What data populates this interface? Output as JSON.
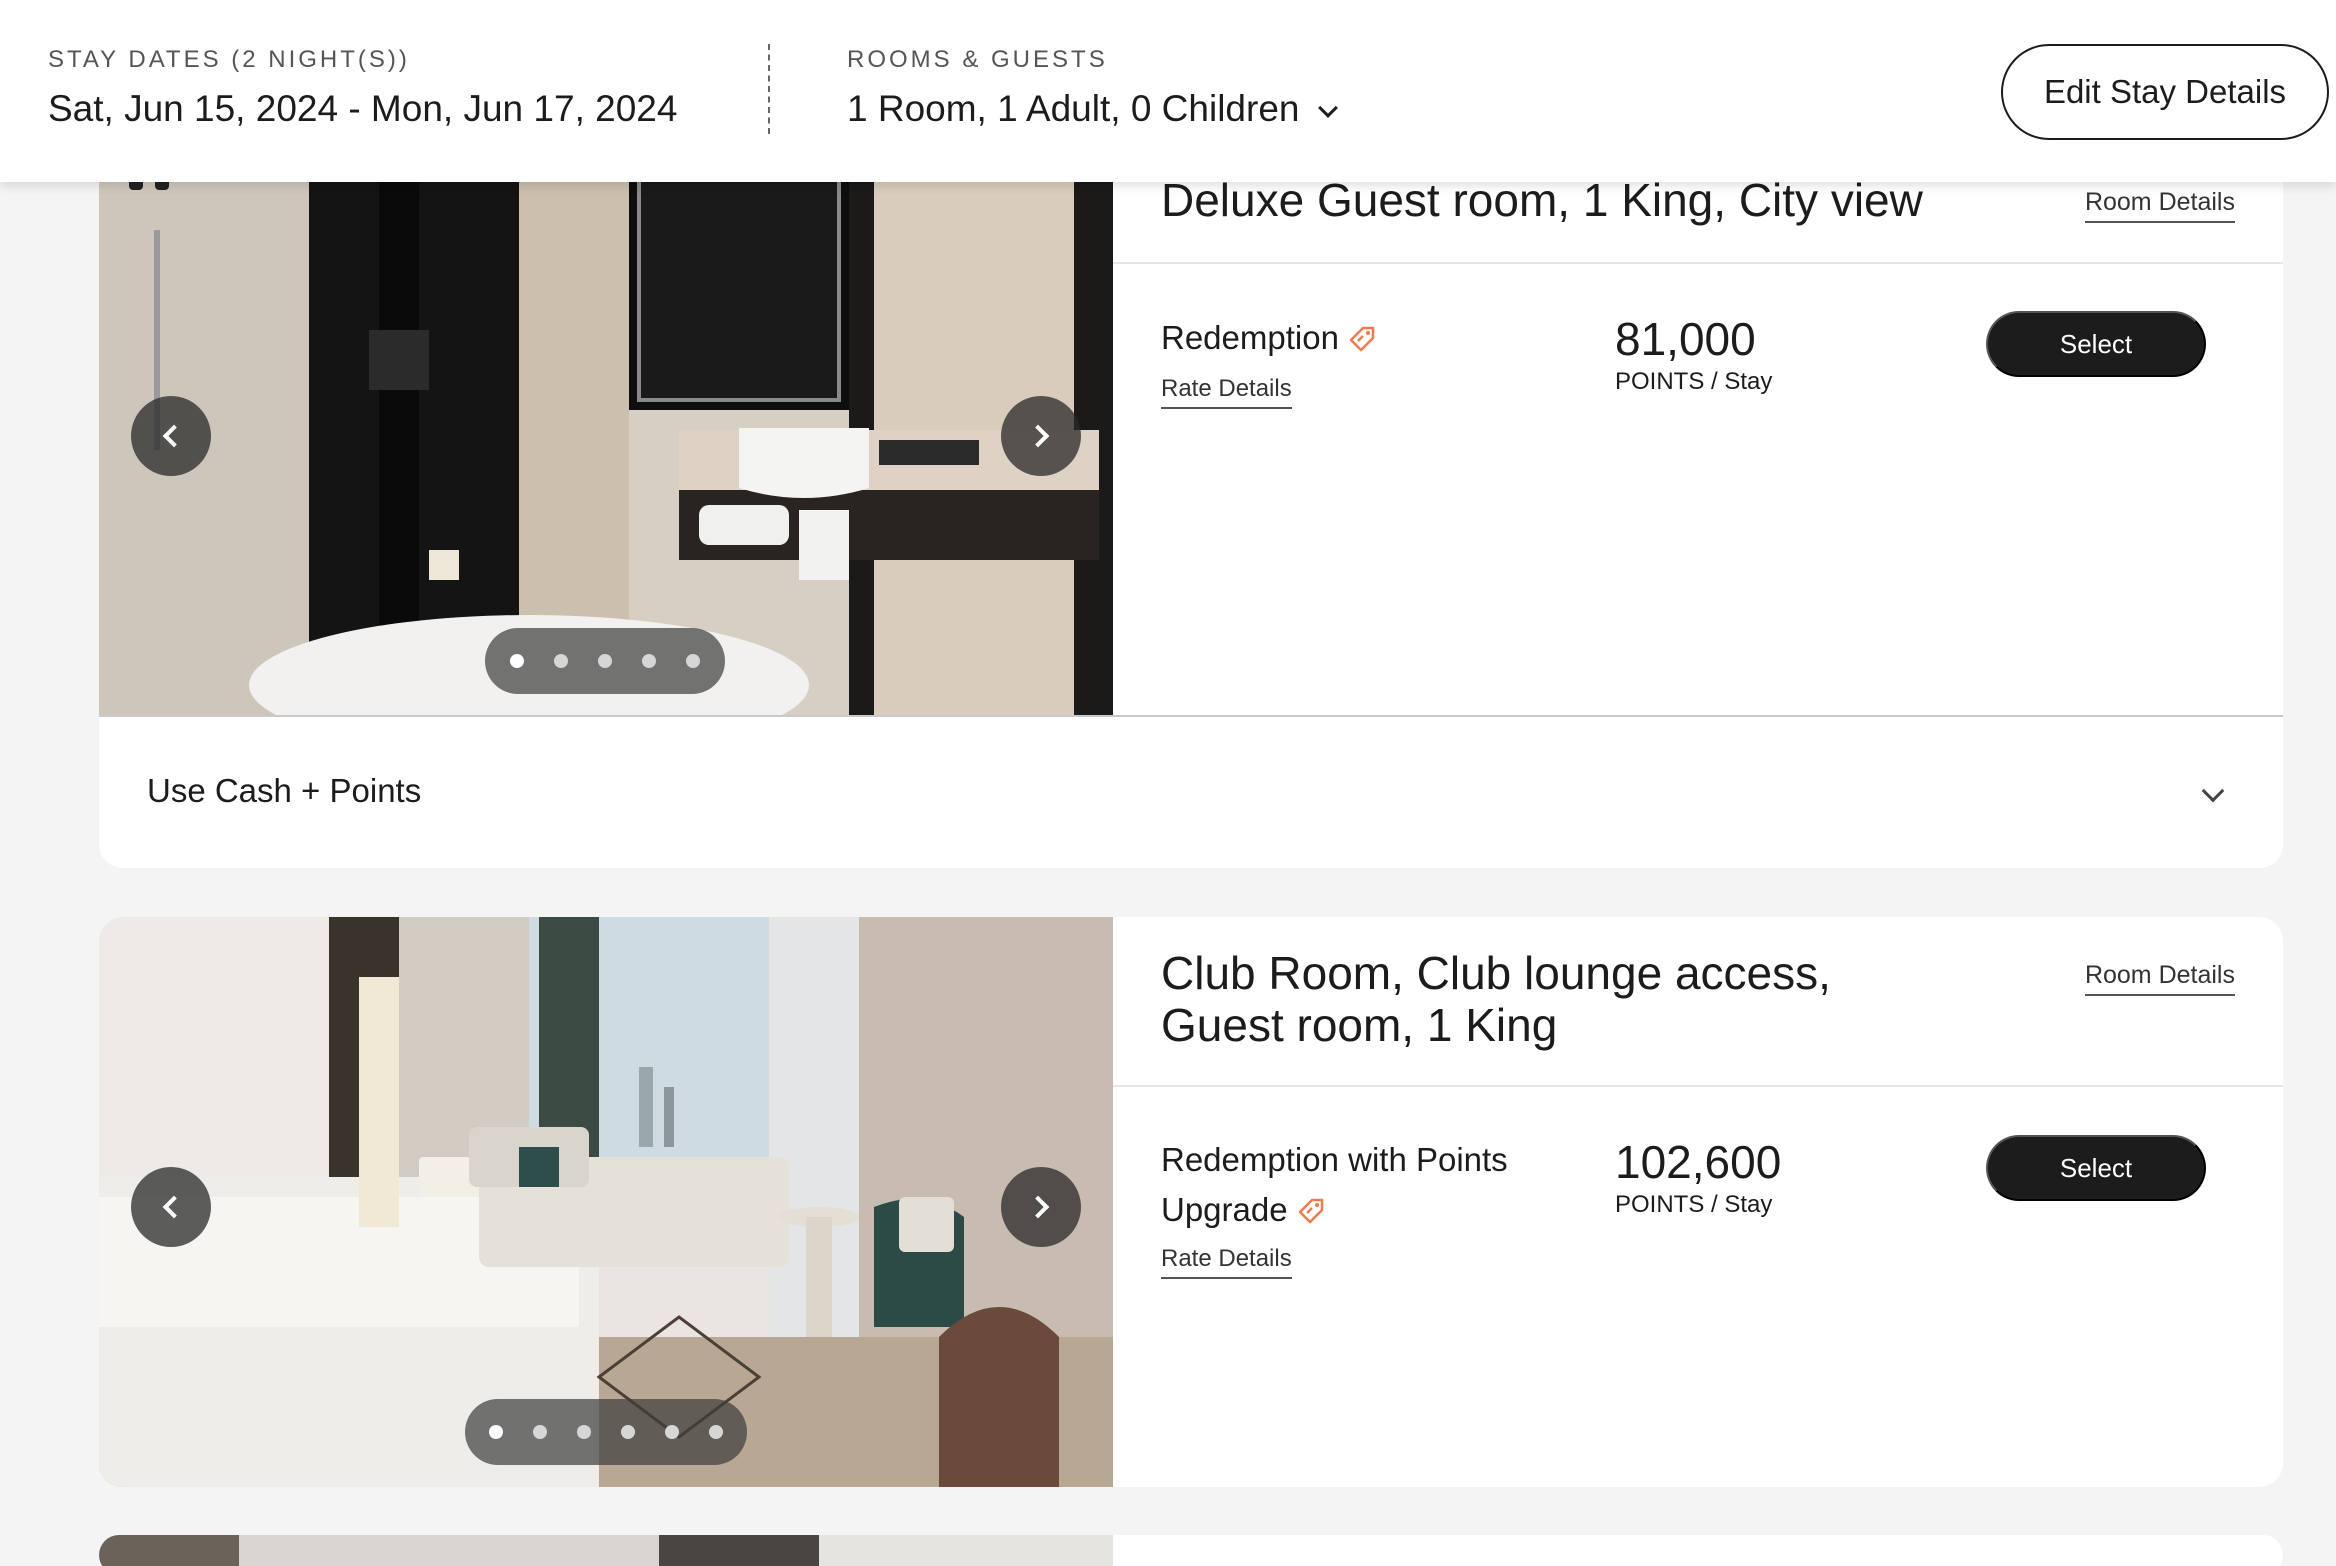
{
  "header": {
    "stay_dates_label": "STAY DATES (2 NIGHT(S))",
    "stay_dates_value": "Sat, Jun 15, 2024 - Mon, Jun 17, 2024",
    "rooms_label": "ROOMS & GUESTS",
    "rooms_value": "1 Room, 1 Adult, 0 Children",
    "edit_button": "Edit Stay Details"
  },
  "rooms": [
    {
      "title": "Deluxe Guest room, 1 King, City view",
      "room_details_link": "Room Details",
      "rate_name": "Redemption",
      "rate_details_link": "Rate Details",
      "points": "81,000",
      "points_unit": "POINTS / Stay",
      "select_label": "Select",
      "photo_count": 5,
      "active_photo": 0,
      "cash_points_label": "Use Cash + Points"
    },
    {
      "title_line1": "Club Room, Club lounge access,",
      "title_line2": "Guest room, 1 King",
      "room_details_link": "Room Details",
      "rate_name_line1": "Redemption with Points",
      "rate_name_line2": "Upgrade",
      "rate_details_link": "Rate Details",
      "points": "102,600",
      "points_unit": "POINTS / Stay",
      "select_label": "Select",
      "photo_count": 6,
      "active_photo": 0
    }
  ],
  "colors": {
    "accent_tag": "#f07a4f",
    "button_dark": "#1c1c1c",
    "page_bg": "#f4f4f4"
  }
}
